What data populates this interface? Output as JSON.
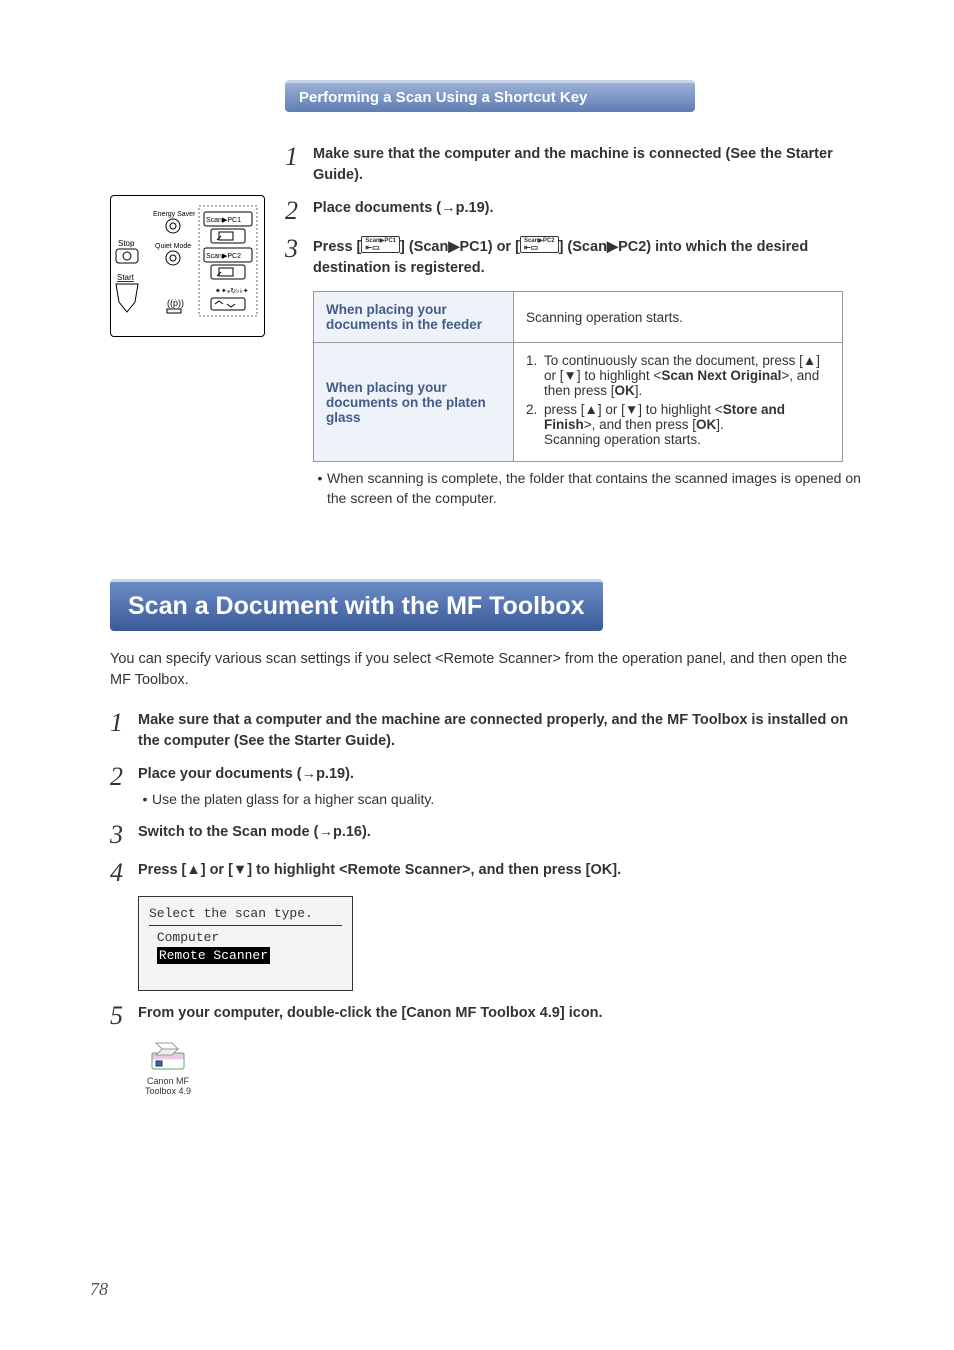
{
  "section1": {
    "title": "Performing a Scan Using a Shortcut Key",
    "step1": "Make sure that the computer and the machine is connected (See the Starter Guide).",
    "step2": "Place documents (→p.19).",
    "step3_a": "Press [",
    "step3_b": "] (Scan▶PC1) or [",
    "step3_c": "] (Scan▶PC2) into which the desired destination is registered.",
    "key1_top": "Scan▶PC1",
    "key2_top": "Scan▶PC2",
    "table": {
      "r1h": "When placing your documents in the feeder",
      "r1v": "Scanning operation starts.",
      "r2h": "When placing your documents on the platen glass",
      "r2_1a": "To continuously scan the document, press [▲] or [▼] to highlight <",
      "r2_1b": "Scan Next Original",
      "r2_1c": ">, and then press [",
      "r2_1d": "OK",
      "r2_1e": "].",
      "r2_2a": "press [▲] or [▼] to highlight <",
      "r2_2b": "Store and Finish",
      "r2_2c": ">, and then press [",
      "r2_2d": "OK",
      "r2_2e": "].",
      "r2_2f": "Scanning operation starts."
    },
    "after": "When scanning is complete, the folder that contains the scanned images is opened on the screen of the computer."
  },
  "section2": {
    "heading": "Scan a Document with the MF Toolbox",
    "intro": "You can specify various scan settings if you select <Remote Scanner> from the operation panel, and then open the MF Toolbox.",
    "step1": "Make sure that a computer and the machine are connected properly, and the MF Toolbox is installed on the computer (See the Starter Guide).",
    "step2": "Place your documents (→p.19).",
    "step2_sub": "Use the platen glass for a higher scan quality.",
    "step3": "Switch to the Scan mode (→p.16).",
    "step4": "Press [▲] or [▼] to highlight <Remote Scanner>, and then press [OK].",
    "lcd": {
      "l1": "Select the scan type.",
      "l2": "Computer",
      "l3": "Remote Scanner"
    },
    "step5": "From your computer, double-click the [Canon MF Toolbox 4.9] icon.",
    "icon_label1": "Canon MF",
    "icon_label2": "Toolbox 4.9"
  },
  "panel": {
    "energy": "Energy Saver",
    "quiet": "Quiet Mode",
    "stop": "Stop",
    "start": "Start",
    "scan1": "Scan▶PC1",
    "scan2": "Scan▶PC2"
  },
  "page_number": "78"
}
